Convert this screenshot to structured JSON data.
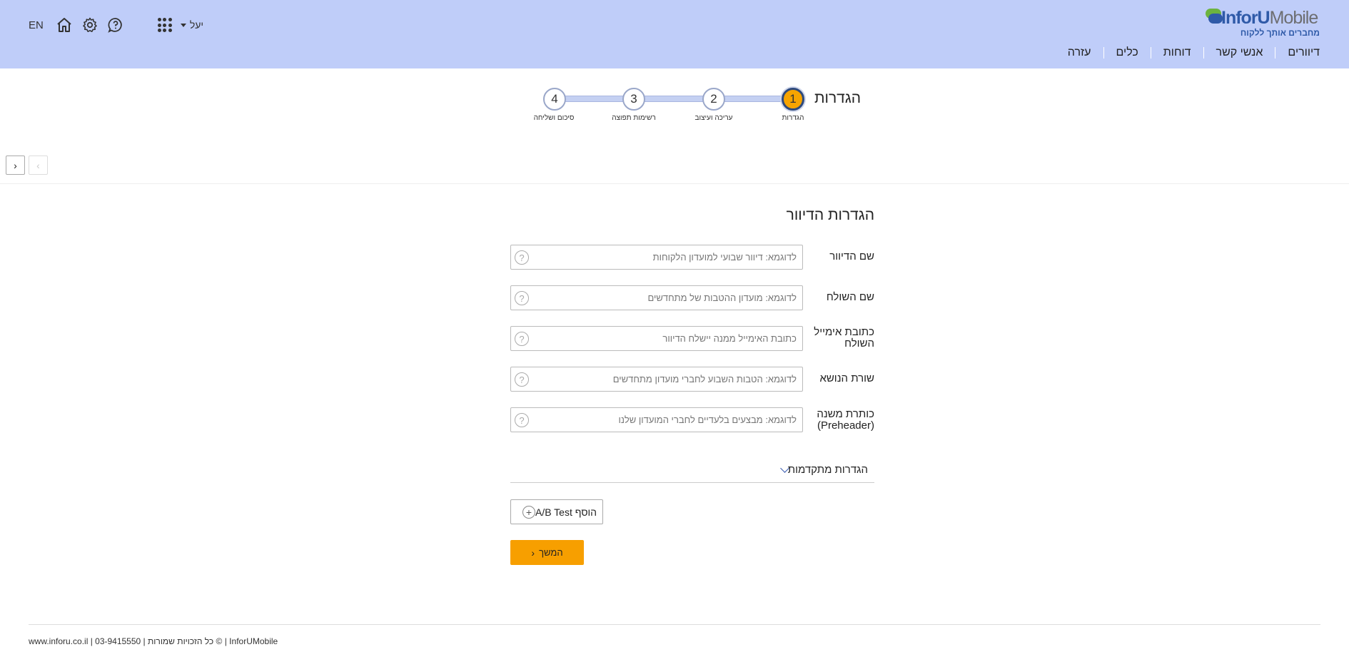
{
  "header": {
    "logo": {
      "brand_part1": "InforU",
      "brand_part2": "Mobile",
      "slogan": "מחברים אותך ללקוח"
    },
    "nav": [
      {
        "label": "דיוורים"
      },
      {
        "label": "אנשי קשר"
      },
      {
        "label": "דוחות"
      },
      {
        "label": "כלים"
      },
      {
        "label": "עזרה"
      }
    ],
    "language": "EN",
    "user_name": "יעל",
    "icons": [
      "home-icon",
      "settings-icon",
      "help-chat-icon",
      "apps-grid-icon"
    ],
    "background_color": "#bfcdf9"
  },
  "stepper": {
    "title": "הגדרות",
    "steps": [
      {
        "number": "1",
        "label": "הגדרות",
        "active": true
      },
      {
        "number": "2",
        "label": "עריכה ועיצוב",
        "active": false
      },
      {
        "number": "3",
        "label": "רשימות תפוצה",
        "active": false
      },
      {
        "number": "4",
        "label": "סיכום ושליחה",
        "active": false
      }
    ],
    "active_color": "#f7a400"
  },
  "pager": {
    "prev_symbol": "‹",
    "next_symbol": "›"
  },
  "form": {
    "title": "הגדרות הדיוור",
    "fields": [
      {
        "label": "שם הדיוור",
        "value": "",
        "placeholder": "לדוגמא: דיוור שבועי למועדון הלקוחות"
      },
      {
        "label": "שם השולח",
        "value": "",
        "placeholder": "לדוגמא: מועדון ההטבות של מתחדשים"
      },
      {
        "label": "כתובת אימייל השולח",
        "value": "",
        "placeholder": "כתובת האימייל ממנה יישלח הדיוור"
      },
      {
        "label": "שורת הנושא",
        "value": "",
        "placeholder": "לדוגמא: הטבות השבוע לחברי מועדון מתחדשים"
      },
      {
        "label": "כותרת משנה (Preheader)",
        "value": "",
        "placeholder": "לדוגמא: מבצעים בלעדיים לחברי המועדון שלנו"
      }
    ],
    "help_symbol": "?",
    "advanced_label": "הגדרות מתקדמות",
    "ab_test_label": "הוסף A/B Test",
    "next_label": "המשך",
    "next_color": "#f79f00"
  },
  "footer": {
    "text": "www.inforu.co.il | 03-9415550 | כל הזכויות שמורות © | InforUMobile"
  }
}
